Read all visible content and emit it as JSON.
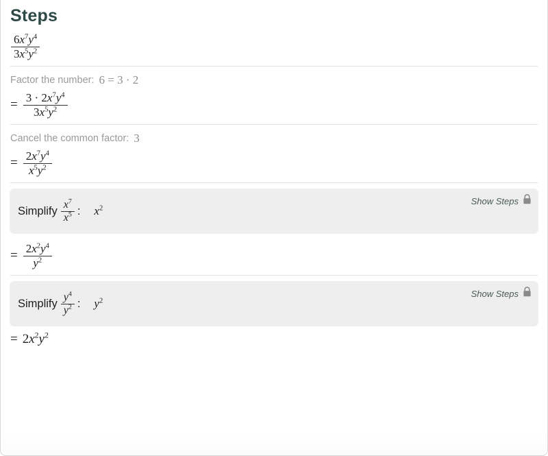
{
  "panel": {
    "title": "Steps"
  },
  "problem": {
    "expression_plain": "6x^7y^4 / 3x^5y^2",
    "numerator": {
      "coef": "6",
      "x_base": "x",
      "x_exp": "7",
      "y_base": "y",
      "y_exp": "4"
    },
    "denominator": {
      "coef": "3",
      "x_base": "x",
      "x_exp": "5",
      "y_base": "y",
      "y_exp": "2"
    }
  },
  "steps": [
    {
      "label": "Factor the number:",
      "label_math": "6 = 3 · 2",
      "eq_sign": "=",
      "result_plain": "3 · 2x^7y^4 / 3x^5y^2",
      "numerator": {
        "lead": "3 ·",
        "coef": "2",
        "x_base": "x",
        "x_exp": "7",
        "y_base": "y",
        "y_exp": "4"
      },
      "denominator": {
        "coef": "3",
        "x_base": "x",
        "x_exp": "5",
        "y_base": "y",
        "y_exp": "2"
      }
    },
    {
      "label": "Cancel the common factor:",
      "label_math": "3",
      "eq_sign": "=",
      "result_plain": "2x^7y^4 / x^5y^2",
      "numerator": {
        "coef": "2",
        "x_base": "x",
        "x_exp": "7",
        "y_base": "y",
        "y_exp": "4"
      },
      "denominator": {
        "coef": "",
        "x_base": "x",
        "x_exp": "5",
        "y_base": "y",
        "y_exp": "2"
      }
    }
  ],
  "cards": [
    {
      "word": "Simplify",
      "colon": ":",
      "frac_num_base": "x",
      "frac_num_exp": "7",
      "frac_den_base": "x",
      "frac_den_exp": "5",
      "result_base": "x",
      "result_exp": "2",
      "show_steps_label": "Show Steps",
      "lock_icon": "lock-icon"
    },
    {
      "word": "Simplify",
      "colon": ":",
      "frac_num_base": "y",
      "frac_num_exp": "4",
      "frac_den_base": "y",
      "frac_den_exp": "2",
      "result_base": "y",
      "result_exp": "2",
      "show_steps_label": "Show Steps",
      "lock_icon": "lock-icon"
    }
  ],
  "after_first_card": {
    "eq_sign": "=",
    "result_plain": "2x^2y^4 / y^2",
    "numerator": {
      "coef": "2",
      "x_base": "x",
      "x_exp": "2",
      "y_base": "y",
      "y_exp": "4"
    },
    "denominator": {
      "y_base": "y",
      "y_exp": "2"
    }
  },
  "final": {
    "eq_sign": "=",
    "result_plain": "2x^2y^2",
    "coef": "2",
    "x_base": "x",
    "x_exp": "2",
    "y_base": "y",
    "y_exp": "2"
  },
  "colors": {
    "title": "#2e4a46",
    "label_gray": "#9a9a9a",
    "card_bg": "#eeeeee",
    "divider": "#e2e2e2",
    "lock": "#8a8a8a",
    "show_steps": "#4a5a58"
  }
}
